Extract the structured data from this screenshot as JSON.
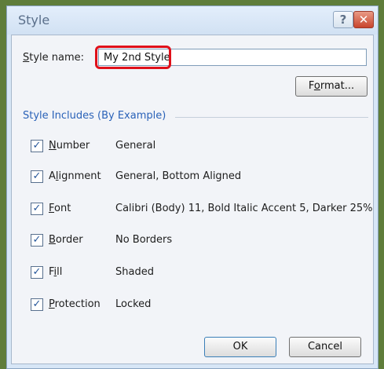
{
  "dialog": {
    "title": "Style",
    "help_glyph": "?",
    "close_glyph": "✕",
    "style_name_label": "Style name:",
    "style_name_value": "My 2nd Style",
    "format_button": "Format...",
    "group_title": "Style Includes (By Example)",
    "ok_button": "OK",
    "cancel_button": "Cancel",
    "highlight_color": "#e0101a"
  },
  "includes": [
    {
      "label": "Number",
      "value": "General",
      "checked": true
    },
    {
      "label": "Alignment",
      "value": "General, Bottom Aligned",
      "checked": true
    },
    {
      "label": "Font",
      "value": "Calibri (Body) 11, Bold Italic Accent 5, Darker 25%",
      "checked": true
    },
    {
      "label": "Border",
      "value": "No Borders",
      "checked": true
    },
    {
      "label": "Fill",
      "value": "Shaded",
      "checked": true
    },
    {
      "label": "Protection",
      "value": "Locked",
      "checked": true
    }
  ],
  "checkmark": "✓"
}
